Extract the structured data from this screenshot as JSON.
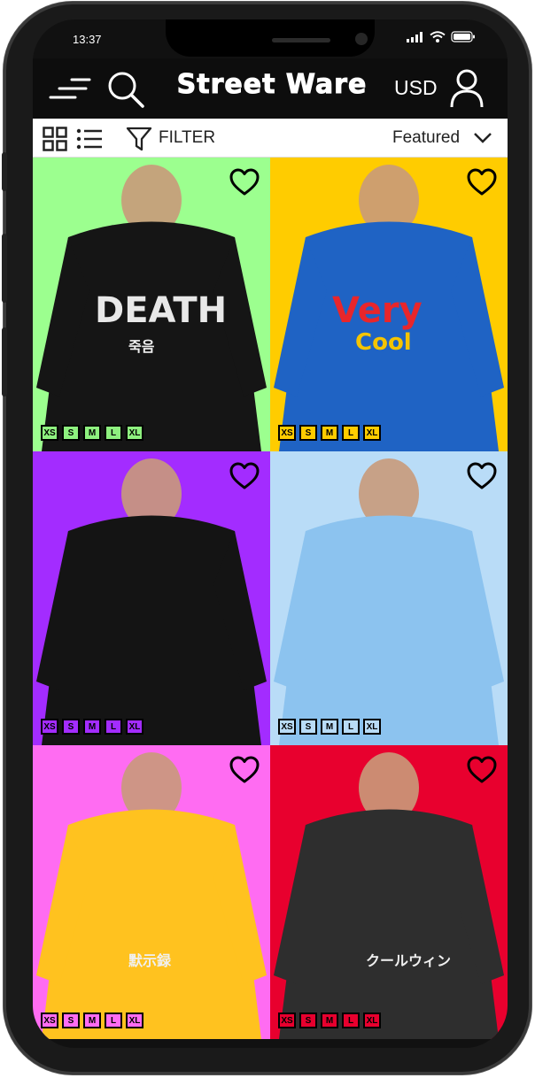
{
  "status": {
    "time": "13:37"
  },
  "header": {
    "brand": "Street Ware",
    "currency": "USD"
  },
  "toolbar": {
    "filter_label": "FILTER",
    "sort_label": "Featured"
  },
  "products": [
    {
      "bg": "#9cff8f",
      "garment": "#151515",
      "print_text": "DEATH",
      "print_sub": "죽음",
      "size_color": "#8ef07f",
      "sizes": [
        "XS",
        "S",
        "M",
        "L",
        "XL"
      ]
    },
    {
      "bg": "#ffcc00",
      "garment": "#1f63c4",
      "print_text": "Very",
      "print_sub": "Cool",
      "size_color": "#ffcc00",
      "sizes": [
        "XS",
        "S",
        "M",
        "L",
        "XL"
      ]
    },
    {
      "bg": "#a32cff",
      "garment": "#141414",
      "print_text": "",
      "print_sub": "",
      "size_color": "#a32cff",
      "sizes": [
        "XS",
        "S",
        "M",
        "L",
        "XL"
      ]
    },
    {
      "bg": "#b9dcf7",
      "garment": "#8cc3ef",
      "print_text": "",
      "print_sub": "",
      "size_color": "#b9dcf7",
      "sizes": [
        "XS",
        "S",
        "M",
        "L",
        "XL"
      ]
    },
    {
      "bg": "#ff6cf2",
      "garment": "#ffc21f",
      "print_text": "",
      "print_sub": "默示録",
      "size_color": "#ff6cf2",
      "sizes": [
        "XS",
        "S",
        "M",
        "L",
        "XL"
      ]
    },
    {
      "bg": "#e8002e",
      "garment": "#2e2e2e",
      "print_text": "",
      "print_sub": "クールウィン",
      "size_color": "#e8002e",
      "sizes": [
        "XS",
        "S",
        "M",
        "L",
        "XL"
      ]
    }
  ],
  "colors": {
    "bar_bg": "#0d0d0d",
    "accent": "#ffffff"
  }
}
